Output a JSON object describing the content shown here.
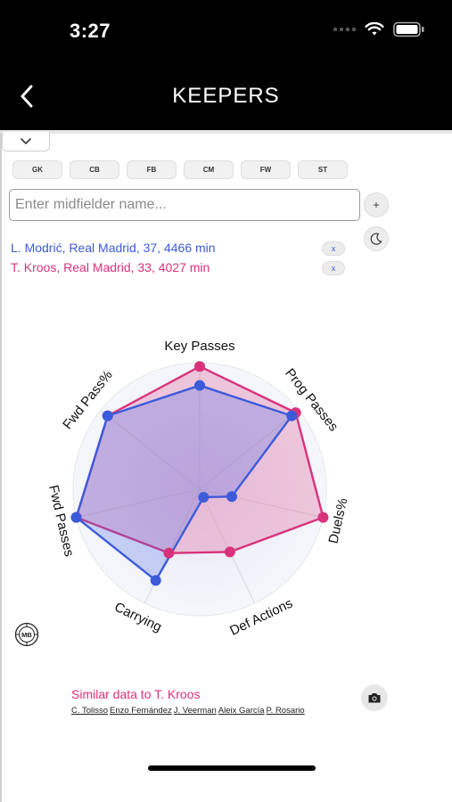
{
  "status": {
    "time": "3:27"
  },
  "nav": {
    "title": "KEEPERS"
  },
  "positions": [
    "GK",
    "CB",
    "FB",
    "CM",
    "FW",
    "ST"
  ],
  "search": {
    "placeholder": "Enter midfielder name...",
    "value": ""
  },
  "buttons": {
    "add": "+",
    "remove": "x"
  },
  "players": [
    {
      "text": "L. Modrić, Real Madrid, 37, 4466 min",
      "color": "#3c5bdb"
    },
    {
      "text": "T. Kroos, Real Madrid, 33, 4027 min",
      "color": "#d8327b"
    }
  ],
  "chart_data": {
    "type": "radar",
    "axes": [
      "Key Passes",
      "Prog Passes",
      "Duels%",
      "Def Actions",
      "Carrying",
      "Fwd Passes",
      "Fwd Pass%"
    ],
    "range": [
      0,
      1
    ],
    "series": [
      {
        "name": "L. Modrić",
        "color": "#3c5bdb",
        "values": [
          0.82,
          0.93,
          0.26,
          0.07,
          0.8,
          1.0,
          0.93
        ]
      },
      {
        "name": "T. Kroos",
        "color": "#d8327b",
        "values": [
          0.97,
          0.97,
          1.0,
          0.55,
          0.56,
          1.0,
          0.93
        ]
      }
    ]
  },
  "similar": {
    "title": "Similar data to T. Kroos",
    "players": [
      "C. Tolisso",
      "Enzo Fernández",
      "J. Veerman",
      "Aleix García",
      "P. Rosario"
    ]
  },
  "icons": {
    "back": "chevron-left-icon",
    "collapse": "chevron-down-icon",
    "moon": "moon-icon",
    "mb": "mb-logo-icon",
    "camera": "camera-icon"
  }
}
